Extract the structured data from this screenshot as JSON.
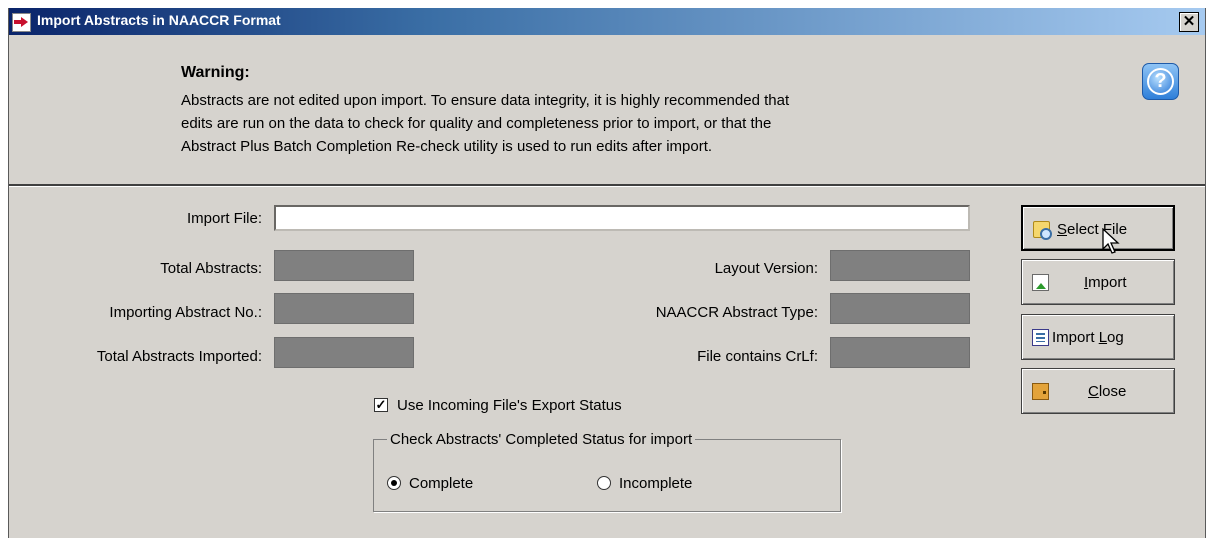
{
  "window": {
    "title": "Import Abstracts in NAACCR Format",
    "close_glyph": "✕"
  },
  "warning": {
    "title": "Warning:",
    "lines": [
      "Abstracts are not edited upon import.  To ensure data integrity, it is highly recommended that",
      "edits are run on the data to check for quality and completeness prior to import, or that the",
      "Abstract Plus Batch Completion Re-check utility is used to run edits after import."
    ]
  },
  "help": {
    "glyph": "?"
  },
  "form": {
    "import_file_label": "Import File:",
    "import_file_value": "",
    "total_abstracts_label": "Total Abstracts:",
    "importing_abstract_label": "Importing Abstract No.:",
    "total_imported_label": "Total Abstracts Imported:",
    "layout_version_label": "Layout Version:",
    "abstract_type_label": "NAACCR Abstract Type:",
    "crlf_label": "File contains CrLf:"
  },
  "buttons": {
    "select_file": {
      "pre": "",
      "accel": "S",
      "post": "elect File"
    },
    "import": {
      "pre": "",
      "accel": "I",
      "post": "mport"
    },
    "import_log": {
      "pre": "Import ",
      "accel": "L",
      "post": "og"
    },
    "close": {
      "pre": "",
      "accel": "C",
      "post": "lose"
    }
  },
  "export_status": {
    "label": "Use Incoming File's Export Status",
    "checked": true,
    "check_glyph": "✓"
  },
  "completed_status": {
    "legend": "Check Abstracts' Completed Status for import",
    "options": [
      {
        "label": "Complete",
        "selected": true
      },
      {
        "label": "Incomplete",
        "selected": false
      }
    ]
  },
  "icons": {
    "app": "import-arrow-icon",
    "help": "help-question-icon",
    "select_file": "folder-search-icon",
    "import": "document-import-icon",
    "import_log": "log-document-icon",
    "close": "door-exit-icon",
    "cursor": "mouse-pointer-icon"
  },
  "colors": {
    "title_start": "#0a246a",
    "title_end": "#a6caf0",
    "face": "#d6d3ce",
    "readout": "#808080"
  }
}
